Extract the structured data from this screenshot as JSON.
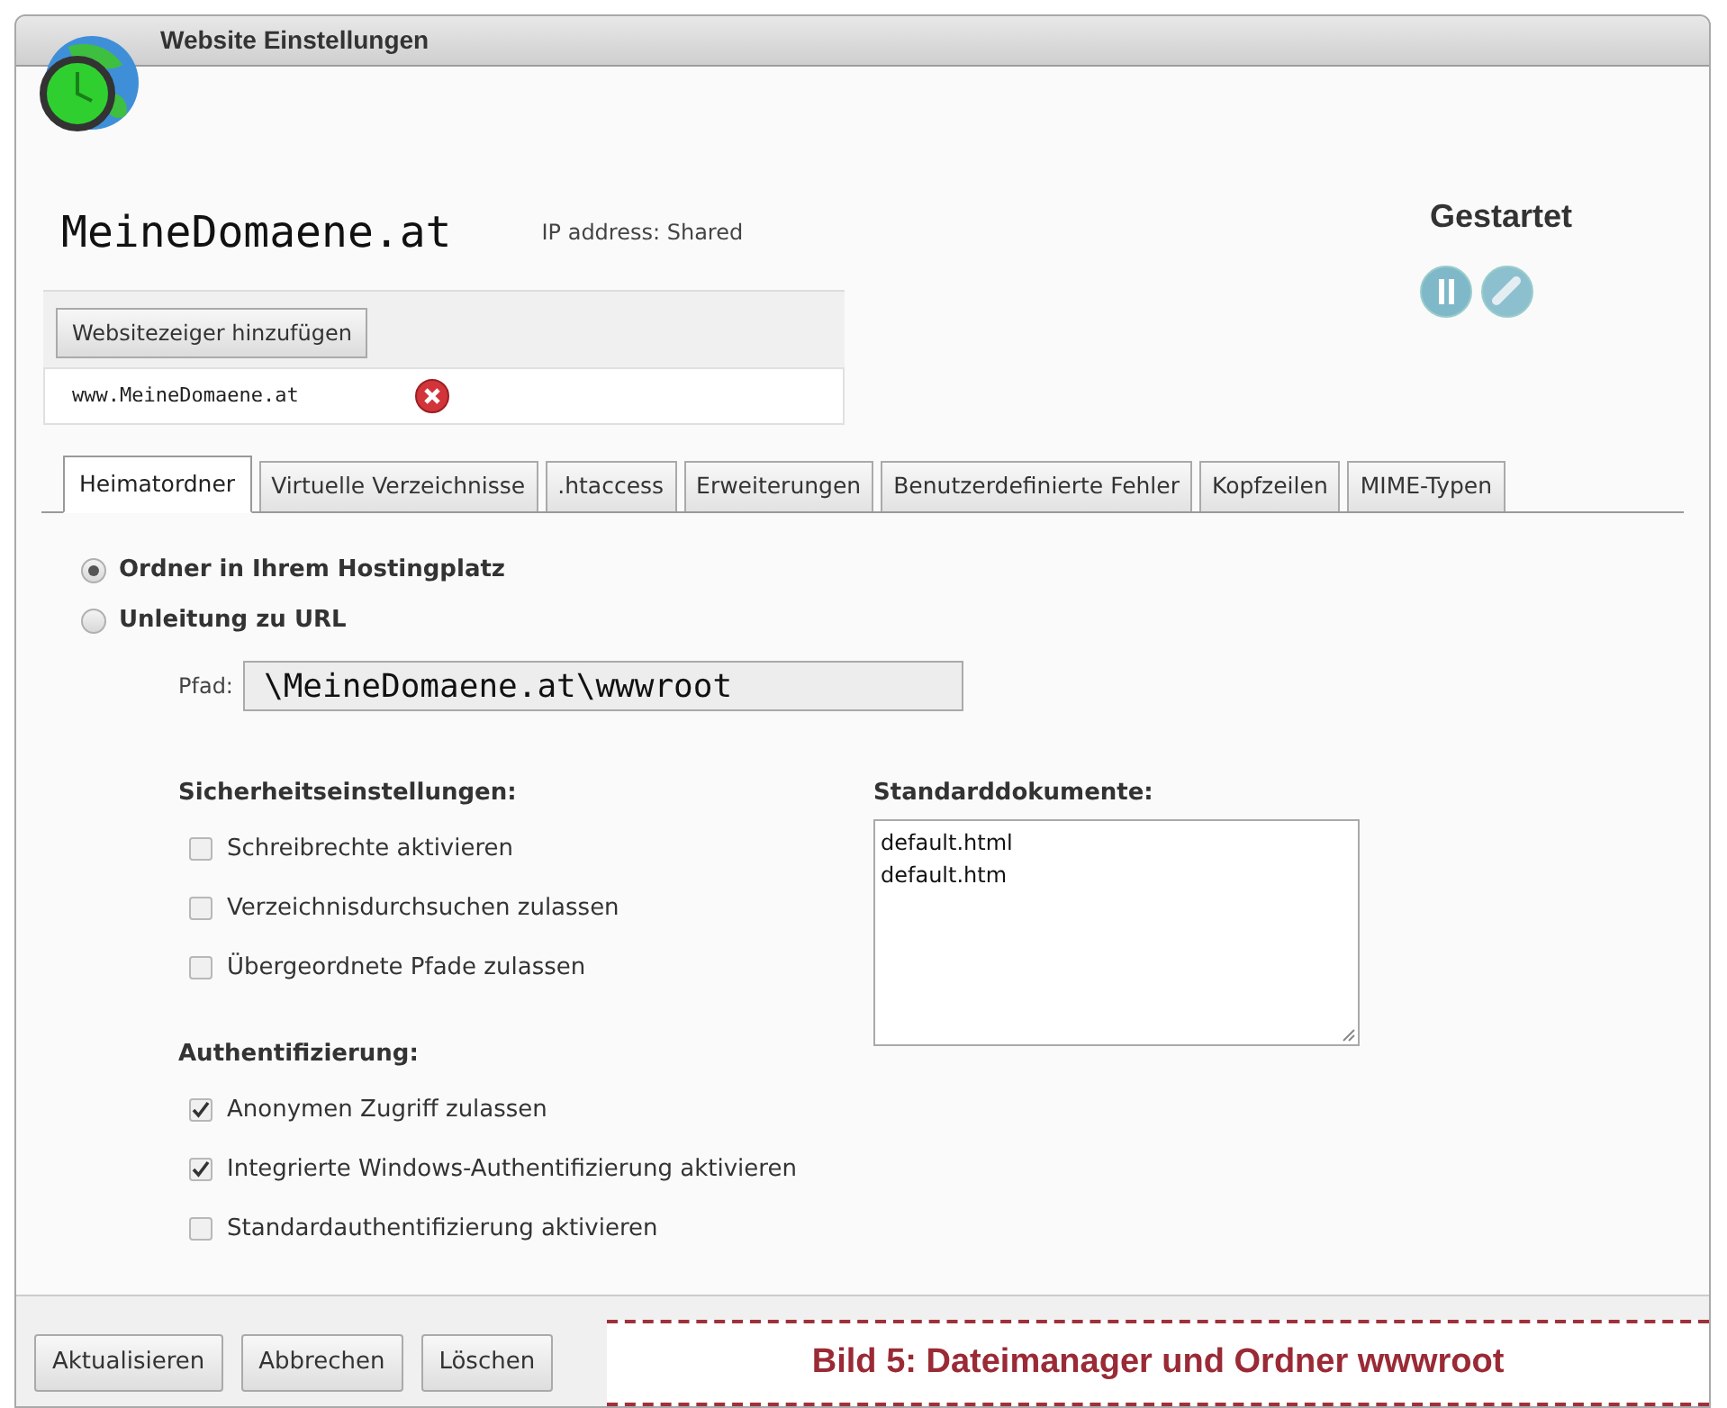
{
  "window": {
    "title": "Website Einstellungen"
  },
  "site": {
    "name": "MeineDomaene.at",
    "ip": "IP address: Shared",
    "status": "Gestartet"
  },
  "bindings": {
    "add_button": "Websitezeiger hinzufügen",
    "items": [
      "www.MeineDomaene.at"
    ]
  },
  "tabs": [
    {
      "label": "Heimatordner",
      "selected": true
    },
    {
      "label": "Virtuelle Verzeichnisse",
      "selected": false
    },
    {
      "label": ".htaccess",
      "selected": false
    },
    {
      "label": "Erweiterungen",
      "selected": false
    },
    {
      "label": "Benutzerdefinierte Fehler",
      "selected": false
    },
    {
      "label": "Kopfzeilen",
      "selected": false
    },
    {
      "label": "MIME-Typen",
      "selected": false
    }
  ],
  "location": [
    {
      "label": "Ordner in Ihrem Hostingplatz",
      "selected": true
    },
    {
      "label": "Unleitung zu URL",
      "selected": false
    }
  ],
  "path": {
    "label": "Pfad:",
    "value": "\\MeineDomaene.at\\wwwroot"
  },
  "security": {
    "title": "Sicherheitseinstellungen:",
    "options": [
      {
        "label": "Schreibrechte aktivieren",
        "checked": false
      },
      {
        "label": "Verzeichnisdurchsuchen zulassen",
        "checked": false
      },
      {
        "label": "Übergeordnete Pfade zulassen",
        "checked": false
      }
    ]
  },
  "auth": {
    "title": "Authentifizierung:",
    "options": [
      {
        "label": "Anonymen Zugriff zulassen",
        "checked": true
      },
      {
        "label": "Integrierte Windows-Authentifizierung aktivieren",
        "checked": true
      },
      {
        "label": "Standardauthentifizierung aktivieren",
        "checked": false
      }
    ]
  },
  "default_documents": {
    "title": "Standarddokumente:",
    "items": [
      "default.html",
      "default.htm"
    ]
  },
  "buttons": [
    "Aktualisieren",
    "Abbrechen",
    "Löschen"
  ],
  "caption": "Bild 5: Dateimanager und Ordner wwwroot"
}
